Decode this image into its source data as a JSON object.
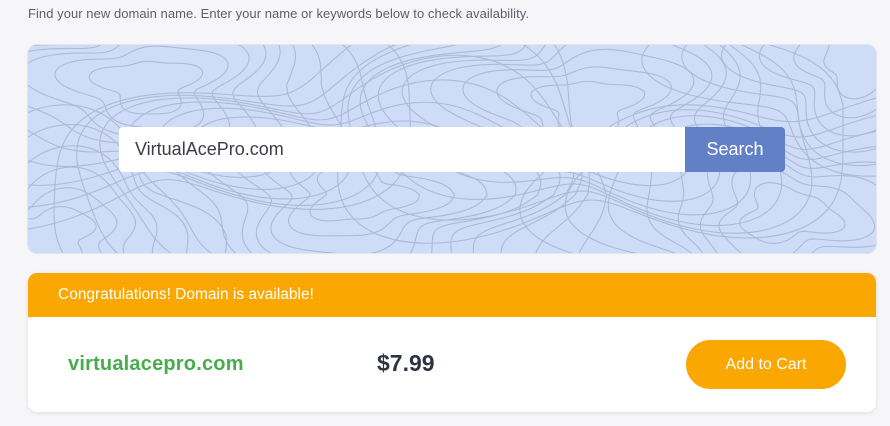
{
  "intro_text": "Find your new domain name. Enter your name or keywords below to check availability.",
  "search": {
    "value": "VirtualAcePro.com",
    "button_label": "Search"
  },
  "result": {
    "banner_text": "Congratulations! Domain is available!",
    "domain": "virtualacepro.com",
    "price": "$7.99",
    "cart_label": "Add to Cart"
  },
  "colors": {
    "page_background": "#f6f6f9",
    "search_panel": "#cfdcf7",
    "topo_lines": "#aab5d6",
    "search_button": "#6280c6",
    "accent_orange": "#fba702",
    "domain_green": "#47ad4b",
    "price_text": "#2e3442"
  }
}
